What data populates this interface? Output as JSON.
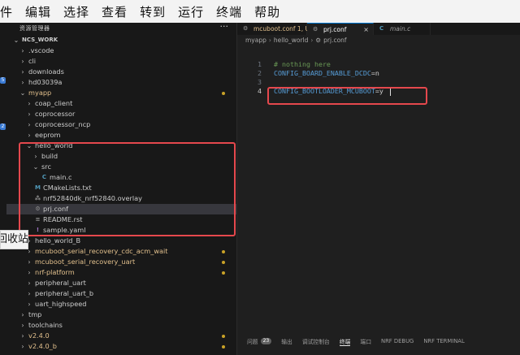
{
  "menu": [
    "件",
    "编辑",
    "选择",
    "查看",
    "转到",
    "运行",
    "终端",
    "帮助"
  ],
  "activity_badges": [
    "5",
    "2"
  ],
  "sidebar": {
    "title": "资源管理器",
    "more": "···",
    "tree": [
      {
        "label": "NCS_WORK",
        "depth": 0,
        "chevron": "⌄",
        "bold": true
      },
      {
        "label": ".vscode",
        "depth": 1,
        "chevron": "›"
      },
      {
        "label": "cli",
        "depth": 1,
        "chevron": "›"
      },
      {
        "label": "downloads",
        "depth": 1,
        "chevron": "›"
      },
      {
        "label": "hd03039a",
        "depth": 1,
        "chevron": "›"
      },
      {
        "label": "myapp",
        "depth": 1,
        "chevron": "⌄",
        "yellow": true,
        "dot": true
      },
      {
        "label": "coap_client",
        "depth": 2,
        "chevron": "›"
      },
      {
        "label": "coprocessor",
        "depth": 2,
        "chevron": "›"
      },
      {
        "label": "coprocessor_ncp",
        "depth": 2,
        "chevron": "›"
      },
      {
        "label": "eeprom",
        "depth": 2,
        "chevron": "›"
      },
      {
        "label": "hello_world",
        "depth": 2,
        "chevron": "⌄"
      },
      {
        "label": "build",
        "depth": 3,
        "chevron": "›"
      },
      {
        "label": "src",
        "depth": 3,
        "chevron": "⌄"
      },
      {
        "label": "main.c",
        "depth": 4,
        "icon": "C",
        "icon_color": "#519aba"
      },
      {
        "label": "CMakeLists.txt",
        "depth": 3,
        "icon": "M",
        "icon_color": "#519aba"
      },
      {
        "label": "nrf52840dk_nrf52840.overlay",
        "depth": 3,
        "icon": "⁂",
        "icon_color": "#8f8f8f"
      },
      {
        "label": "prj.conf",
        "depth": 3,
        "icon": "⚙",
        "icon_color": "#8f8f8f",
        "selected": true
      },
      {
        "label": "README.rst",
        "depth": 3,
        "icon": "≡",
        "icon_color": "#8f8f8f"
      },
      {
        "label": "sample.yaml",
        "depth": 3,
        "icon": "!",
        "icon_color": "#a074c4"
      },
      {
        "label": "hello_world_B",
        "depth": 2,
        "chevron": "›"
      },
      {
        "label": "mcuboot_serial_recovery_cdc_acm_wait",
        "depth": 2,
        "chevron": "›",
        "yellow": true,
        "dot": true
      },
      {
        "label": "mcuboot_serial_recovery_uart",
        "depth": 2,
        "chevron": "›",
        "yellow": true,
        "dot": true
      },
      {
        "label": "nrf-platform",
        "depth": 2,
        "chevron": "›",
        "yellow": true,
        "dot": true
      },
      {
        "label": "peripheral_uart",
        "depth": 2,
        "chevron": "›"
      },
      {
        "label": "peripheral_uart_b",
        "depth": 2,
        "chevron": "›"
      },
      {
        "label": "uart_highspeed",
        "depth": 2,
        "chevron": "›"
      },
      {
        "label": "tmp",
        "depth": 1,
        "chevron": "›"
      },
      {
        "label": "toolchains",
        "depth": 1,
        "chevron": "›"
      },
      {
        "label": "v2.4.0",
        "depth": 1,
        "chevron": "›",
        "yellow": true,
        "dot": true
      },
      {
        "label": "v2.4.0_b",
        "depth": 1,
        "chevron": "›",
        "yellow": true,
        "dot": true
      }
    ]
  },
  "tooltip": "回收站",
  "tabs": [
    {
      "label": "mcuboot.conf 1, U",
      "icon": "⚙",
      "active": false
    },
    {
      "label": "prj.conf",
      "icon": "⚙",
      "active": true,
      "close": "×"
    },
    {
      "label": "main.c",
      "icon": "C",
      "active": false
    }
  ],
  "breadcrumb": {
    "parts": [
      "myapp",
      "hello_world",
      "prj.conf"
    ],
    "sep": "›",
    "file_icon": "⚙"
  },
  "code": {
    "lines": [
      {
        "num": "1",
        "type": "comment",
        "text": "# nothing here"
      },
      {
        "num": "2",
        "type": "kv",
        "key": "CONFIG_BOARD_ENABLE_DCDC",
        "val": "=n"
      },
      {
        "num": "3",
        "type": "empty",
        "text": ""
      },
      {
        "num": "4",
        "type": "kv",
        "key": "CONFIG_BOOTLOADER_MCUBOOT",
        "val": "=y",
        "current": true
      }
    ]
  },
  "panel": {
    "tabs": [
      {
        "label": "问题",
        "badge": "23"
      },
      {
        "label": "输出"
      },
      {
        "label": "调试控制台"
      },
      {
        "label": "终端",
        "active": true
      },
      {
        "label": "端口"
      },
      {
        "label": "NRF DEBUG"
      },
      {
        "label": "NRF TERMINAL"
      }
    ]
  },
  "colors": {
    "highlight_box": "#e5484d",
    "folder_modified": "#e2c08d",
    "accent": "#0078d4"
  }
}
